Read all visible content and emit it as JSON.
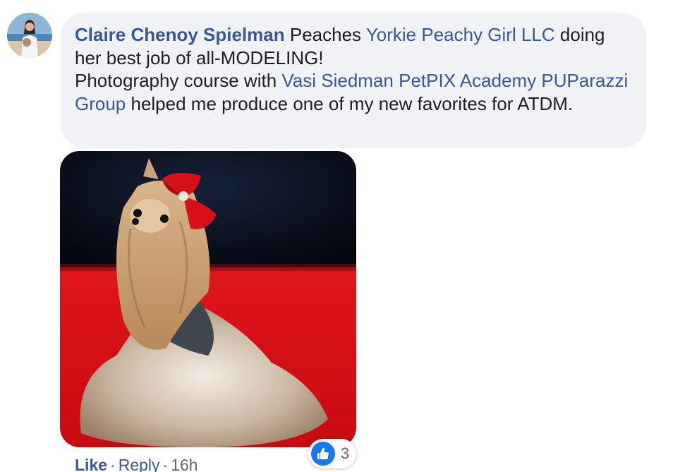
{
  "comment": {
    "author": "Claire Chenoy Spielman",
    "text_1": " Peaches ",
    "mention_1": "Yorkie Peachy Girl LLC",
    "text_2": " doing her best job of all-MODELING!",
    "text_3": "Photography course with ",
    "mention_2": "Vasi Siedman PetPIX Academy PUParazzi Group",
    "text_4": " helped me produce one of my new favorites for ATDM."
  },
  "reactions": {
    "icon": "thumbs-up-icon",
    "count": "3"
  },
  "actions": {
    "like_label": "Like",
    "separator": "·",
    "reply_label": "Reply",
    "time": "16h"
  },
  "colors": {
    "link": "#385898",
    "bubble": "#f0f2f5",
    "like_blue": "#1877f2"
  }
}
